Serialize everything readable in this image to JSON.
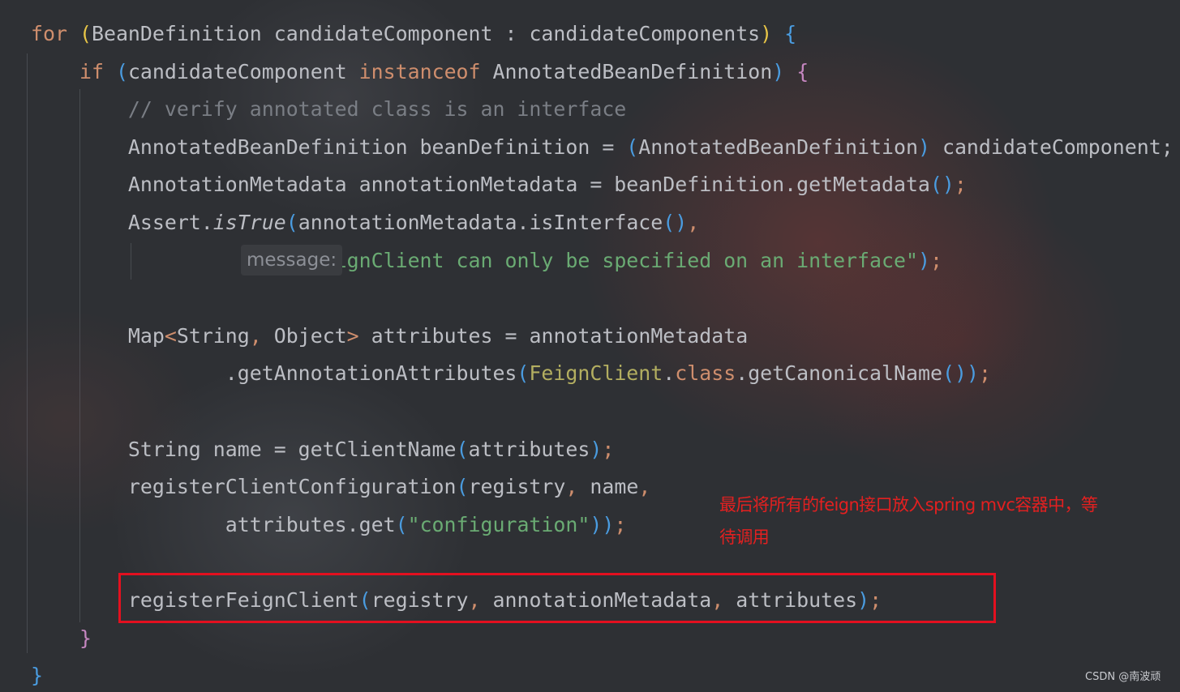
{
  "theme": {
    "keyword": "#cf8e6d",
    "identifier": "#bcbec4",
    "comment": "#7a7e85",
    "string": "#6aab73",
    "annotation_class": "#b3ae60",
    "bracket_level_1": "#e7c547",
    "bracket_level_2": "#c586c0",
    "bracket_level_3": "#4a9ce0",
    "annotation_text": "#e32020",
    "highlight_box": "#e3101f"
  },
  "editor": {
    "lines": [
      {
        "tokens": [
          {
            "t": "for",
            "c": "kw"
          },
          {
            "t": " ",
            "c": "pn"
          },
          {
            "t": "(",
            "c": "p1"
          },
          {
            "t": "BeanDefinition candidateComponent : candidateComponents",
            "c": "id"
          },
          {
            "t": ")",
            "c": "p1"
          },
          {
            "t": " ",
            "c": "pn"
          },
          {
            "t": "{",
            "c": "p3"
          }
        ]
      },
      {
        "tokens": [
          {
            "t": "    ",
            "c": "pn"
          },
          {
            "t": "if",
            "c": "kw"
          },
          {
            "t": " ",
            "c": "pn"
          },
          {
            "t": "(",
            "c": "p3"
          },
          {
            "t": "candidateComponent ",
            "c": "id"
          },
          {
            "t": "instanceof",
            "c": "kw"
          },
          {
            "t": " AnnotatedBeanDefinition",
            "c": "id"
          },
          {
            "t": ")",
            "c": "p3"
          },
          {
            "t": " ",
            "c": "pn"
          },
          {
            "t": "{",
            "c": "p2"
          }
        ]
      },
      {
        "tokens": [
          {
            "t": "        ",
            "c": "pn"
          },
          {
            "t": "// verify annotated class is an interface",
            "c": "cm"
          }
        ]
      },
      {
        "tokens": [
          {
            "t": "        AnnotatedBeanDefinition beanDefinition = ",
            "c": "id"
          },
          {
            "t": "(",
            "c": "p3"
          },
          {
            "t": "AnnotatedBeanDefinition",
            "c": "id"
          },
          {
            "t": ")",
            "c": "p3"
          },
          {
            "t": " candidateComponent;",
            "c": "id"
          }
        ]
      },
      {
        "tokens": [
          {
            "t": "        AnnotationMetadata annotationMetadata = beanDefinition.getMetadata",
            "c": "id"
          },
          {
            "t": "()",
            "c": "p3"
          },
          {
            "t": ";",
            "c": "kw"
          }
        ]
      },
      {
        "tokens": [
          {
            "t": "        Assert.",
            "c": "id"
          },
          {
            "t": "isTrue",
            "c": "it"
          },
          {
            "t": "(",
            "c": "p3"
          },
          {
            "t": "annotationMetadata.isInterface",
            "c": "id"
          },
          {
            "t": "()",
            "c": "p3"
          },
          {
            "t": ",",
            "c": "kw"
          }
        ]
      },
      {
        "hint": "message:",
        "tokens": [
          {
            "t": "                ",
            "c": "pn"
          },
          {
            "t": "     ",
            "c": "pn"
          },
          {
            "t": "\"@FeignClient can only be specified on an interface\"",
            "c": "st"
          },
          {
            "t": ")",
            "c": "p3"
          },
          {
            "t": ";",
            "c": "kw"
          }
        ]
      },
      {
        "tokens": []
      },
      {
        "tokens": [
          {
            "t": "        Map",
            "c": "id"
          },
          {
            "t": "<",
            "c": "kw"
          },
          {
            "t": "String",
            "c": "id"
          },
          {
            "t": ",",
            "c": "kw"
          },
          {
            "t": " Object",
            "c": "id"
          },
          {
            "t": ">",
            "c": "kw"
          },
          {
            "t": " attributes = annotationMetadata",
            "c": "id"
          }
        ]
      },
      {
        "tokens": [
          {
            "t": "                .getAnnotationAttributes",
            "c": "id"
          },
          {
            "t": "(",
            "c": "p3"
          },
          {
            "t": "FeignClient",
            "c": "an"
          },
          {
            "t": ".",
            "c": "id"
          },
          {
            "t": "class",
            "c": "kw"
          },
          {
            "t": ".getCanonicalName",
            "c": "id"
          },
          {
            "t": "()",
            "c": "p3"
          },
          {
            "t": ")",
            "c": "p3"
          },
          {
            "t": ";",
            "c": "kw"
          }
        ]
      },
      {
        "tokens": []
      },
      {
        "tokens": [
          {
            "t": "        String name = getClientName",
            "c": "id"
          },
          {
            "t": "(",
            "c": "p3"
          },
          {
            "t": "attributes",
            "c": "id"
          },
          {
            "t": ")",
            "c": "p3"
          },
          {
            "t": ";",
            "c": "kw"
          }
        ]
      },
      {
        "tokens": [
          {
            "t": "        registerClientConfiguration",
            "c": "id"
          },
          {
            "t": "(",
            "c": "p3"
          },
          {
            "t": "registry",
            "c": "id"
          },
          {
            "t": ",",
            "c": "kw"
          },
          {
            "t": " name",
            "c": "id"
          },
          {
            "t": ",",
            "c": "kw"
          }
        ]
      },
      {
        "tokens": [
          {
            "t": "                attributes.get",
            "c": "id"
          },
          {
            "t": "(",
            "c": "p3"
          },
          {
            "t": "\"configuration\"",
            "c": "st"
          },
          {
            "t": "))",
            "c": "p3"
          },
          {
            "t": ";",
            "c": "kw"
          }
        ]
      },
      {
        "tokens": []
      },
      {
        "tokens": [
          {
            "t": "        registerFeignClient",
            "c": "id"
          },
          {
            "t": "(",
            "c": "p3"
          },
          {
            "t": "registry",
            "c": "id"
          },
          {
            "t": ",",
            "c": "kw"
          },
          {
            "t": " annotationMetadata",
            "c": "id"
          },
          {
            "t": ",",
            "c": "kw"
          },
          {
            "t": " attributes",
            "c": "id"
          },
          {
            "t": ")",
            "c": "p3"
          },
          {
            "t": ";",
            "c": "kw"
          }
        ]
      },
      {
        "tokens": [
          {
            "t": "    ",
            "c": "pn"
          },
          {
            "t": "}",
            "c": "p2"
          }
        ]
      },
      {
        "tokens": [
          {
            "t": "}",
            "c": "p3"
          }
        ]
      }
    ]
  },
  "annotation": {
    "line1": "最后将所有的feign接口放入spring mvc容器中，等",
    "line2": "待调用"
  },
  "watermark": "CSDN @南波顽"
}
